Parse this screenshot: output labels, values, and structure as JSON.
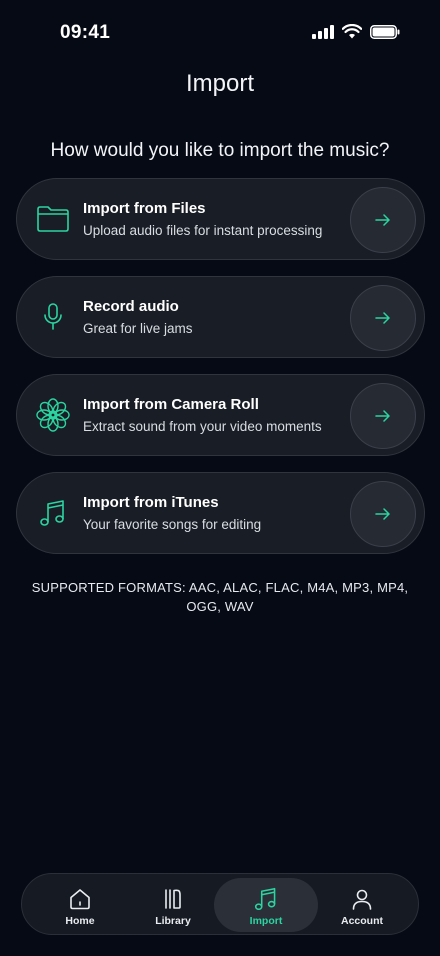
{
  "status_bar": {
    "time": "09:41"
  },
  "header": {
    "title": "Import"
  },
  "main": {
    "question": "How would you like to import the music?",
    "options": [
      {
        "title": "Import from Files",
        "subtitle": "Upload audio files for instant processing",
        "icon": "folder-icon"
      },
      {
        "title": "Record audio",
        "subtitle": "Great for live jams",
        "icon": "microphone-icon"
      },
      {
        "title": "Import from Camera Roll",
        "subtitle": "Extract sound from your video moments",
        "icon": "flower-icon"
      },
      {
        "title": "Import from iTunes",
        "subtitle": "Your favorite songs for editing",
        "icon": "music-note-icon"
      }
    ],
    "formats": "SUPPORTED FORMATS: AAC, ALAC, FLAC, M4A, MP3, MP4, OGG, WAV"
  },
  "tabbar": {
    "items": [
      {
        "label": "Home",
        "icon": "home-icon"
      },
      {
        "label": "Library",
        "icon": "library-icon"
      },
      {
        "label": "Import",
        "icon": "music-note-icon",
        "active": true
      },
      {
        "label": "Account",
        "icon": "user-icon"
      }
    ]
  },
  "colors": {
    "accent": "#2bd4a0",
    "background": "#060a14",
    "card": "#191d25"
  }
}
